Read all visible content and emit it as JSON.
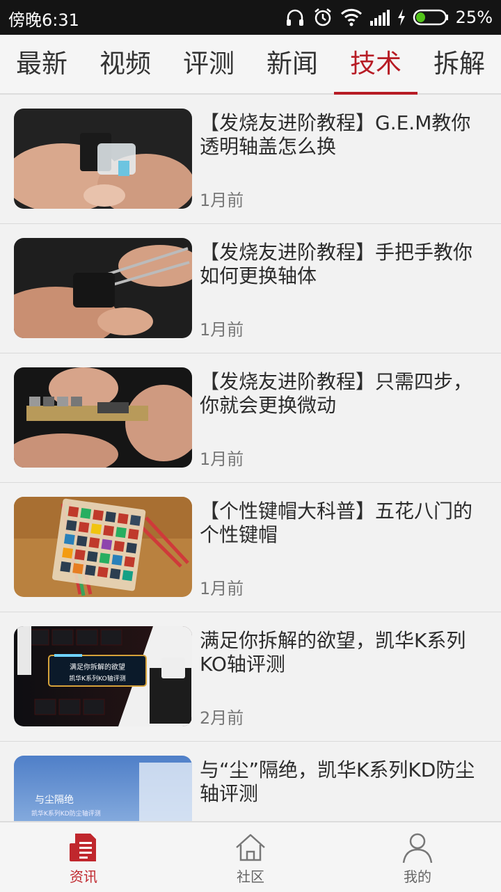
{
  "status_bar": {
    "time": "傍晚6:31",
    "battery": "25%"
  },
  "tabs": [
    {
      "label": "最新"
    },
    {
      "label": "视频"
    },
    {
      "label": "评测"
    },
    {
      "label": "新闻"
    },
    {
      "label": "技术",
      "active": true
    },
    {
      "label": "拆解"
    }
  ],
  "articles": [
    {
      "title": "【发烧友进阶教程】G.E.M教你透明轴盖怎么换",
      "date": "1月前"
    },
    {
      "title": "【发烧友进阶教程】手把手教你如何更换轴体",
      "date": "1月前"
    },
    {
      "title": "【发烧友进阶教程】只需四步，你就会更换微动",
      "date": "1月前"
    },
    {
      "title": "【个性键帽大科普】五花八门的个性键帽",
      "date": "1月前"
    },
    {
      "title": "满足你拆解的欲望，凯华K系列KO轴评测",
      "date": "2月前",
      "thumb_text": [
        "满足你拆解的欲望",
        "凯华K系列KO轴评测"
      ]
    },
    {
      "title": "与“尘”隔绝，凯华K系列KD防尘轴评测",
      "date": "",
      "thumb_text": [
        "与尘隔绝",
        "凯华K系列KD防尘轴评测"
      ]
    }
  ],
  "bottom_nav": [
    {
      "label": "资讯",
      "icon": "news-icon",
      "active": true
    },
    {
      "label": "社区",
      "icon": "home-icon"
    },
    {
      "label": "我的",
      "icon": "person-icon"
    }
  ],
  "colors": {
    "accent": "#b71c25",
    "status_bar": "#141414"
  }
}
